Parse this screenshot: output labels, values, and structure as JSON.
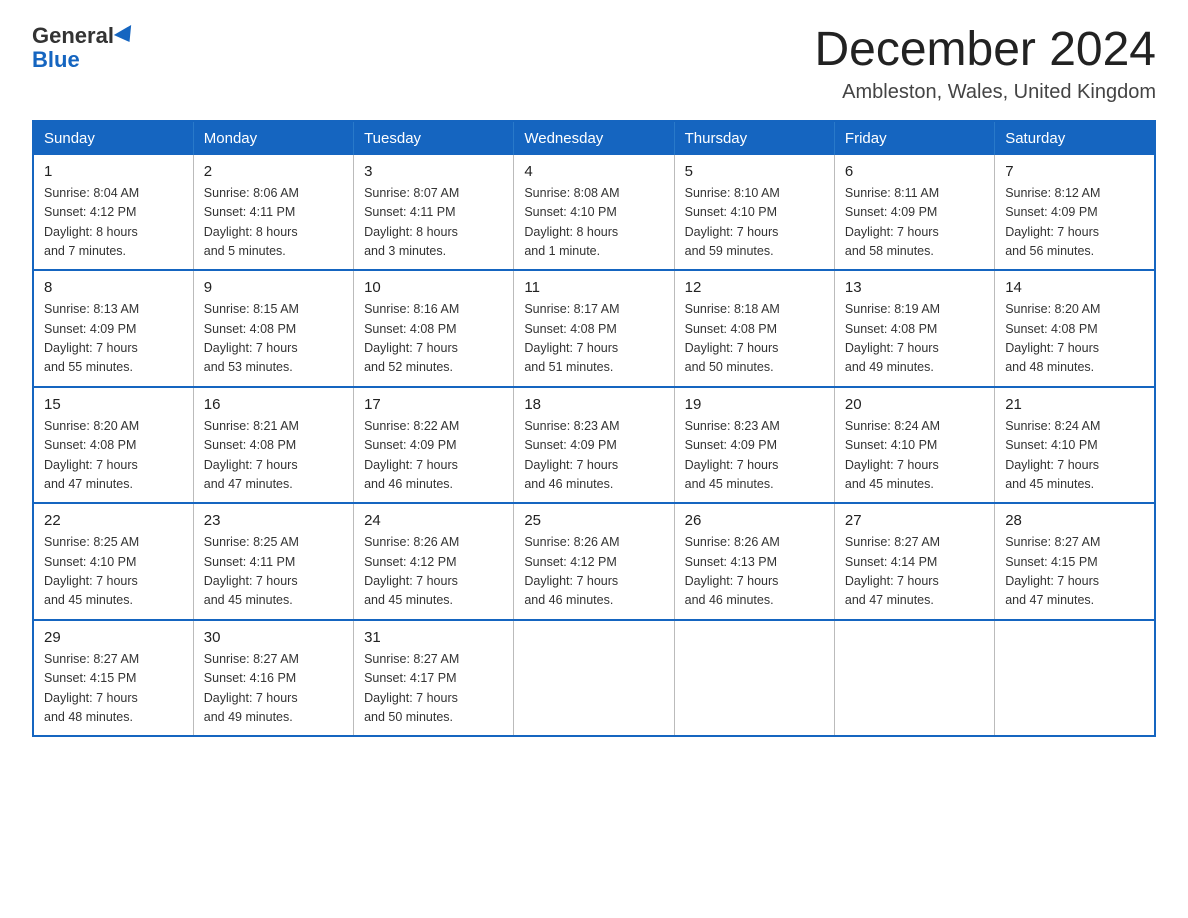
{
  "logo": {
    "general": "General",
    "blue": "Blue"
  },
  "title": "December 2024",
  "subtitle": "Ambleston, Wales, United Kingdom",
  "headers": [
    "Sunday",
    "Monday",
    "Tuesday",
    "Wednesday",
    "Thursday",
    "Friday",
    "Saturday"
  ],
  "weeks": [
    [
      {
        "day": "1",
        "sunrise": "8:04 AM",
        "sunset": "4:12 PM",
        "daylight": "8 hours and 7 minutes."
      },
      {
        "day": "2",
        "sunrise": "8:06 AM",
        "sunset": "4:11 PM",
        "daylight": "8 hours and 5 minutes."
      },
      {
        "day": "3",
        "sunrise": "8:07 AM",
        "sunset": "4:11 PM",
        "daylight": "8 hours and 3 minutes."
      },
      {
        "day": "4",
        "sunrise": "8:08 AM",
        "sunset": "4:10 PM",
        "daylight": "8 hours and 1 minute."
      },
      {
        "day": "5",
        "sunrise": "8:10 AM",
        "sunset": "4:10 PM",
        "daylight": "7 hours and 59 minutes."
      },
      {
        "day": "6",
        "sunrise": "8:11 AM",
        "sunset": "4:09 PM",
        "daylight": "7 hours and 58 minutes."
      },
      {
        "day": "7",
        "sunrise": "8:12 AM",
        "sunset": "4:09 PM",
        "daylight": "7 hours and 56 minutes."
      }
    ],
    [
      {
        "day": "8",
        "sunrise": "8:13 AM",
        "sunset": "4:09 PM",
        "daylight": "7 hours and 55 minutes."
      },
      {
        "day": "9",
        "sunrise": "8:15 AM",
        "sunset": "4:08 PM",
        "daylight": "7 hours and 53 minutes."
      },
      {
        "day": "10",
        "sunrise": "8:16 AM",
        "sunset": "4:08 PM",
        "daylight": "7 hours and 52 minutes."
      },
      {
        "day": "11",
        "sunrise": "8:17 AM",
        "sunset": "4:08 PM",
        "daylight": "7 hours and 51 minutes."
      },
      {
        "day": "12",
        "sunrise": "8:18 AM",
        "sunset": "4:08 PM",
        "daylight": "7 hours and 50 minutes."
      },
      {
        "day": "13",
        "sunrise": "8:19 AM",
        "sunset": "4:08 PM",
        "daylight": "7 hours and 49 minutes."
      },
      {
        "day": "14",
        "sunrise": "8:20 AM",
        "sunset": "4:08 PM",
        "daylight": "7 hours and 48 minutes."
      }
    ],
    [
      {
        "day": "15",
        "sunrise": "8:20 AM",
        "sunset": "4:08 PM",
        "daylight": "7 hours and 47 minutes."
      },
      {
        "day": "16",
        "sunrise": "8:21 AM",
        "sunset": "4:08 PM",
        "daylight": "7 hours and 47 minutes."
      },
      {
        "day": "17",
        "sunrise": "8:22 AM",
        "sunset": "4:09 PM",
        "daylight": "7 hours and 46 minutes."
      },
      {
        "day": "18",
        "sunrise": "8:23 AM",
        "sunset": "4:09 PM",
        "daylight": "7 hours and 46 minutes."
      },
      {
        "day": "19",
        "sunrise": "8:23 AM",
        "sunset": "4:09 PM",
        "daylight": "7 hours and 45 minutes."
      },
      {
        "day": "20",
        "sunrise": "8:24 AM",
        "sunset": "4:10 PM",
        "daylight": "7 hours and 45 minutes."
      },
      {
        "day": "21",
        "sunrise": "8:24 AM",
        "sunset": "4:10 PM",
        "daylight": "7 hours and 45 minutes."
      }
    ],
    [
      {
        "day": "22",
        "sunrise": "8:25 AM",
        "sunset": "4:10 PM",
        "daylight": "7 hours and 45 minutes."
      },
      {
        "day": "23",
        "sunrise": "8:25 AM",
        "sunset": "4:11 PM",
        "daylight": "7 hours and 45 minutes."
      },
      {
        "day": "24",
        "sunrise": "8:26 AM",
        "sunset": "4:12 PM",
        "daylight": "7 hours and 45 minutes."
      },
      {
        "day": "25",
        "sunrise": "8:26 AM",
        "sunset": "4:12 PM",
        "daylight": "7 hours and 46 minutes."
      },
      {
        "day": "26",
        "sunrise": "8:26 AM",
        "sunset": "4:13 PM",
        "daylight": "7 hours and 46 minutes."
      },
      {
        "day": "27",
        "sunrise": "8:27 AM",
        "sunset": "4:14 PM",
        "daylight": "7 hours and 47 minutes."
      },
      {
        "day": "28",
        "sunrise": "8:27 AM",
        "sunset": "4:15 PM",
        "daylight": "7 hours and 47 minutes."
      }
    ],
    [
      {
        "day": "29",
        "sunrise": "8:27 AM",
        "sunset": "4:15 PM",
        "daylight": "7 hours and 48 minutes."
      },
      {
        "day": "30",
        "sunrise": "8:27 AM",
        "sunset": "4:16 PM",
        "daylight": "7 hours and 49 minutes."
      },
      {
        "day": "31",
        "sunrise": "8:27 AM",
        "sunset": "4:17 PM",
        "daylight": "7 hours and 50 minutes."
      },
      null,
      null,
      null,
      null
    ]
  ],
  "labels": {
    "sunrise": "Sunrise:",
    "sunset": "Sunset:",
    "daylight": "Daylight:"
  }
}
